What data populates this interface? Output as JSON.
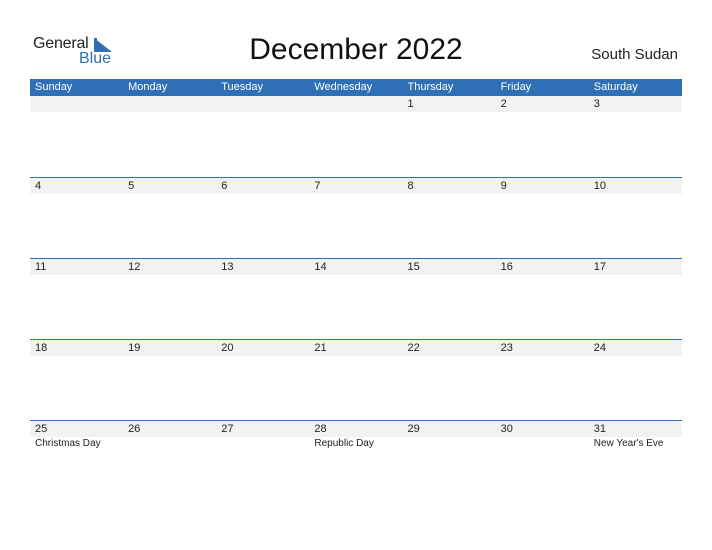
{
  "logo": {
    "line1": "General",
    "line2": "Blue"
  },
  "title": "December 2022",
  "country": "South Sudan",
  "colors": {
    "accent": "#2e6fb5",
    "date_row_bg": "#f2f2f2"
  },
  "weekdays": [
    "Sunday",
    "Monday",
    "Tuesday",
    "Wednesday",
    "Thursday",
    "Friday",
    "Saturday"
  ],
  "weeks": [
    {
      "days": [
        "",
        "",
        "",
        "",
        "1",
        "2",
        "3"
      ],
      "events": [
        "",
        "",
        "",
        "",
        "",
        "",
        ""
      ]
    },
    {
      "days": [
        "4",
        "5",
        "6",
        "7",
        "8",
        "9",
        "10"
      ],
      "events": [
        "",
        "",
        "",
        "",
        "",
        "",
        ""
      ]
    },
    {
      "days": [
        "11",
        "12",
        "13",
        "14",
        "15",
        "16",
        "17"
      ],
      "events": [
        "",
        "",
        "",
        "",
        "",
        "",
        ""
      ]
    },
    {
      "days": [
        "18",
        "19",
        "20",
        "21",
        "22",
        "23",
        "24"
      ],
      "events": [
        "",
        "",
        "",
        "",
        "",
        "",
        ""
      ]
    },
    {
      "days": [
        "25",
        "26",
        "27",
        "28",
        "29",
        "30",
        "31"
      ],
      "events": [
        "Christmas Day",
        "",
        "",
        "Republic Day",
        "",
        "",
        "New Year's Eve"
      ]
    }
  ]
}
